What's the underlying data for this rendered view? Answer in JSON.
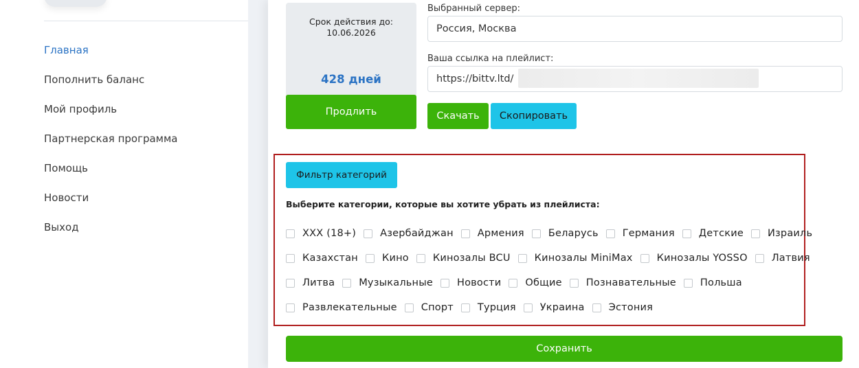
{
  "sidebar": {
    "items": [
      {
        "label": "Главная",
        "active": true
      },
      {
        "label": "Пополнить баланс"
      },
      {
        "label": "Мой профиль"
      },
      {
        "label": "Партнерская программа"
      },
      {
        "label": "Помощь"
      },
      {
        "label": "Новости"
      },
      {
        "label": "Выход"
      }
    ]
  },
  "subscription": {
    "expire_label": "Срок действия до:",
    "expire_date": "10.06.2026",
    "days_left": "428 дней",
    "extend_label": "Продлить"
  },
  "server": {
    "label": "Выбранный сервер:",
    "value": "Россия, Москва"
  },
  "playlist": {
    "label": "Ваша ссылка на плейлист:",
    "value": "https://bittv.ltd/",
    "download_label": "Скачать",
    "copy_label": "Скопировать"
  },
  "filter": {
    "button_label": "Фильтр категорий",
    "instruction": "Выберите категории, которые вы хотите убрать из плейлиста:",
    "rows": [
      [
        "XXX (18+)",
        "Азербайджан",
        "Армения",
        "Беларусь",
        "Германия",
        "Детские",
        "Израиль"
      ],
      [
        "Казахстан",
        "Кино",
        "Кинозалы BCU",
        "Кинозалы MiniMax",
        "Кинозалы YOSSO",
        "Латвия"
      ],
      [
        "Литва",
        "Музыкальные",
        "Новости",
        "Общие",
        "Познавательные",
        "Польша"
      ],
      [
        "Развлекательные",
        "Спорт",
        "Турция",
        "Украина",
        "Эстония"
      ]
    ]
  },
  "save_label": "Сохранить",
  "colors": {
    "green": "#3cb30a",
    "cyan": "#1ec4e8",
    "link_blue": "#2b73c4",
    "highlight_red": "#b01e1e"
  }
}
